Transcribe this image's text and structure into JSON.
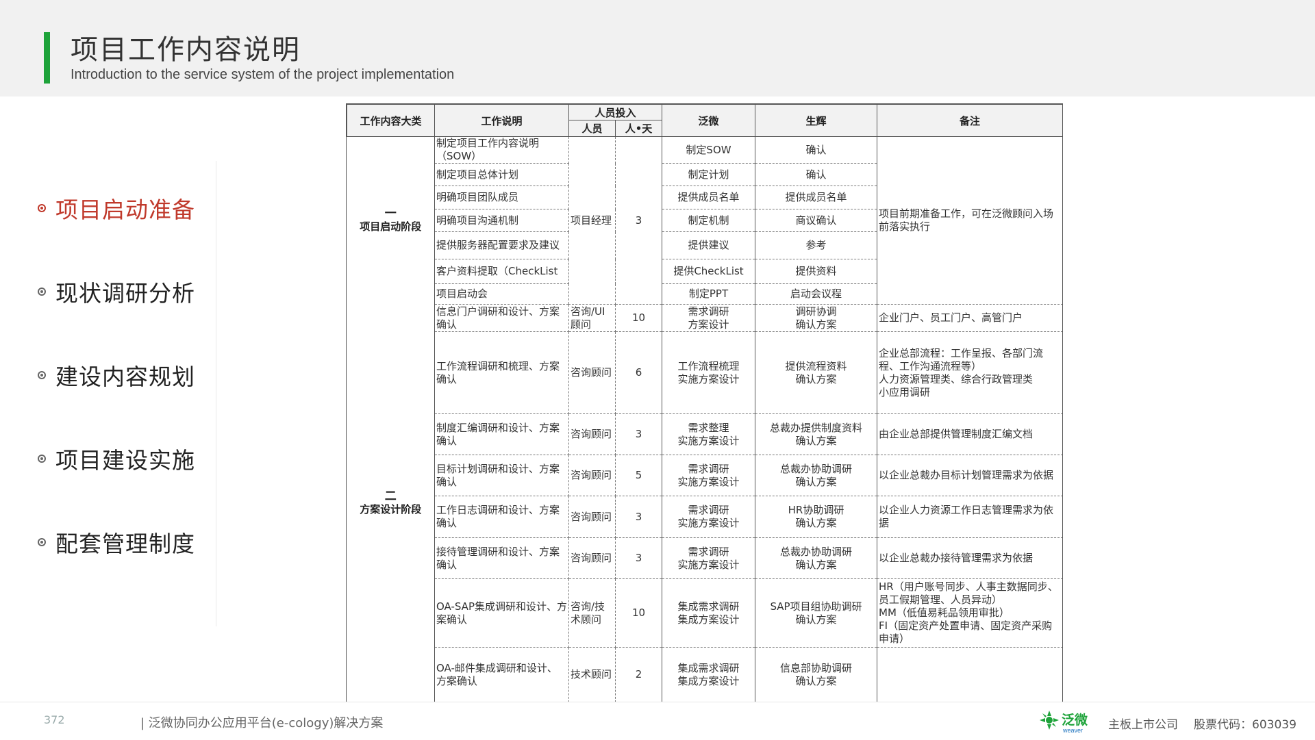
{
  "header": {
    "title": "项目工作内容说明",
    "subtitle": "Introduction to the service system of the project implementation"
  },
  "nav": [
    {
      "label": "项目启动准备",
      "active": true
    },
    {
      "label": "现状调研分析",
      "active": false
    },
    {
      "label": "建设内容规划",
      "active": false
    },
    {
      "label": "项目建设实施",
      "active": false
    },
    {
      "label": "配套管理制度",
      "active": false
    }
  ],
  "table": {
    "headers": {
      "category": "工作内容大类",
      "desc": "工作说明",
      "staff": "人员投入",
      "person": "人员",
      "days": "人•天",
      "fanwei": "泛微",
      "client": "生辉",
      "note": "备注"
    },
    "groups": [
      {
        "roman": "一",
        "name": "项目启动阶段"
      },
      {
        "roman": "二",
        "name": "方案设计阶段"
      }
    ],
    "rows": [
      {
        "desc": "制定项目工作内容说明（SOW）",
        "person": "项目经理",
        "days": "3",
        "fw": "制定SOW",
        "cl": "确认",
        "note": "项目前期准备工作，可在泛微顾问入场前落实执行"
      },
      {
        "desc": "制定项目总体计划",
        "fw": "制定计划",
        "cl": "确认"
      },
      {
        "desc": "明确项目团队成员",
        "fw": "提供成员名单",
        "cl": "提供成员名单"
      },
      {
        "desc": "明确项目沟通机制",
        "fw": "制定机制",
        "cl": "商议确认"
      },
      {
        "desc": "提供服务器配置要求及建议",
        "fw": "提供建议",
        "cl": "参考"
      },
      {
        "desc": "客户资料提取（CheckList",
        "fw": "提供CheckList",
        "cl": "提供资料"
      },
      {
        "desc": "项目启动会",
        "fw": "制定PPT",
        "cl": "启动会议程"
      },
      {
        "desc": "信息门户调研和设计、方案确认",
        "person": "咨询/UI顾问",
        "days": "10",
        "fw": "需求调研\n方案设计",
        "cl": "调研协调\n确认方案",
        "note": "企业门户、员工门户、高管门户"
      },
      {
        "desc": "工作流程调研和梳理、方案确认",
        "person": "咨询顾问",
        "days": "6",
        "fw": "工作流程梳理\n实施方案设计",
        "cl": "提供流程资料\n确认方案",
        "note": "企业总部流程：工作呈报、各部门流程、工作沟通流程等）\n人力资源管理类、综合行政管理类\n小应用调研"
      },
      {
        "desc": "制度汇编调研和设计、方案确认",
        "person": "咨询顾问",
        "days": "3",
        "fw": "需求整理\n实施方案设计",
        "cl": "总裁办提供制度资料\n确认方案",
        "note": "由企业总部提供管理制度汇编文档"
      },
      {
        "desc": "目标计划调研和设计、方案确认",
        "person": "咨询顾问",
        "days": "5",
        "fw": "需求调研\n实施方案设计",
        "cl": "总裁办协助调研\n确认方案",
        "note": "以企业总裁办目标计划管理需求为依据"
      },
      {
        "desc": "工作日志调研和设计、方案确认",
        "person": "咨询顾问",
        "days": "3",
        "fw": "需求调研\n实施方案设计",
        "cl": "HR协助调研\n确认方案",
        "note": "以企业人力资源工作日志管理需求为依据"
      },
      {
        "desc": "接待管理调研和设计、方案确认",
        "person": "咨询顾问",
        "days": "3",
        "fw": "需求调研\n实施方案设计",
        "cl": "总裁办协助调研\n确认方案",
        "note": "以企业总裁办接待管理需求为依据"
      },
      {
        "desc": "OA-SAP集成调研和设计、方案确认",
        "person": "咨询/技术顾问",
        "days": "10",
        "fw": "集成需求调研\n集成方案设计",
        "cl": "SAP项目组协助调研\n确认方案",
        "note": "HR（用户账号同步、人事主数据同步、员工假期管理、人员异动）\nMM（低值易耗品领用审批）\nFI（固定资产处置申请、固定资产采购申请）"
      },
      {
        "desc": "OA-邮件集成调研和设计、方案确认",
        "person": "技术顾问",
        "days": "2",
        "fw": "集成需求调研\n集成方案设计",
        "cl": "信息部协助调研\n确认方案",
        "note": ""
      }
    ]
  },
  "footer": {
    "page": "372",
    "doc": "| 泛微协同办公应用平台(e-cology)解决方案",
    "logo_text": "泛微",
    "logo_sub": "weaver",
    "listed": "主板上市公司",
    "stock": "股票代码：603039"
  },
  "colors": {
    "accent_green": "#1ea33a",
    "active_red": "#c0392b"
  }
}
